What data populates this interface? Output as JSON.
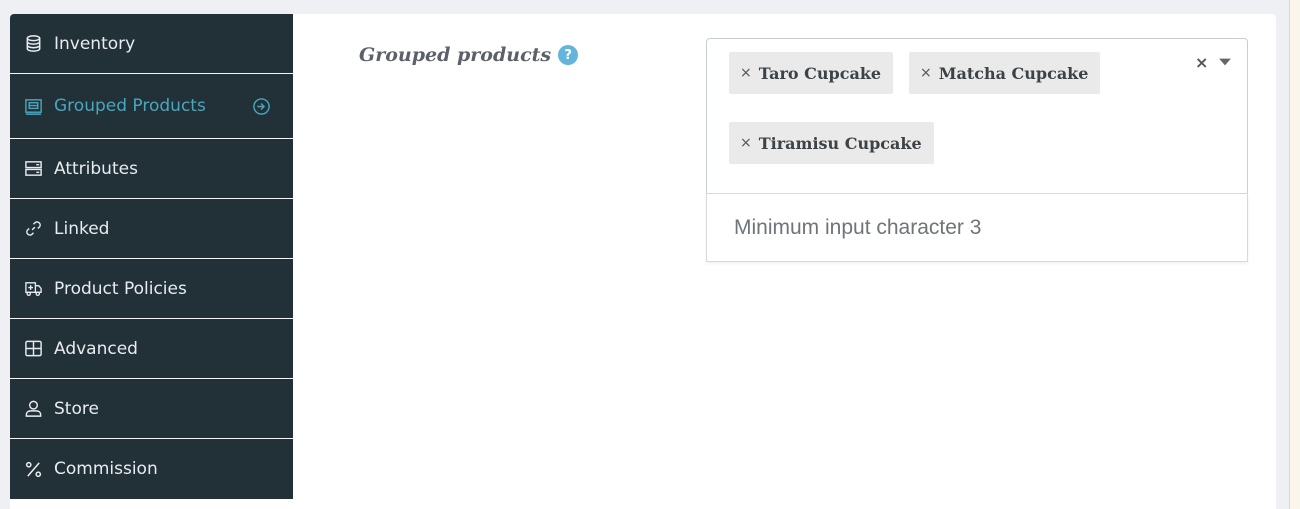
{
  "sidebar": {
    "items": [
      {
        "label": "Inventory",
        "icon": "database-icon",
        "active": false
      },
      {
        "label": "Grouped Products",
        "icon": "grouped-products-icon",
        "active": true
      },
      {
        "label": "Attributes",
        "icon": "server-icon",
        "active": false
      },
      {
        "label": "Linked",
        "icon": "link-icon",
        "active": false
      },
      {
        "label": "Product Policies",
        "icon": "ambulance-icon",
        "active": false
      },
      {
        "label": "Advanced",
        "icon": "grid-icon",
        "active": false
      },
      {
        "label": "Store",
        "icon": "user-icon",
        "active": false
      },
      {
        "label": "Commission",
        "icon": "percent-icon",
        "active": false
      }
    ]
  },
  "field": {
    "label": "Grouped products",
    "help": "?"
  },
  "select": {
    "tags": [
      "Taro Cupcake",
      "Matcha Cupcake",
      "Tiramisu Cupcake"
    ],
    "tag_remove": "×",
    "clear": "×",
    "message": "Minimum input character 3"
  },
  "colors": {
    "sidebar_bg": "#223038",
    "active_text": "#4aa6bd",
    "help_icon": "#64b5dc"
  }
}
